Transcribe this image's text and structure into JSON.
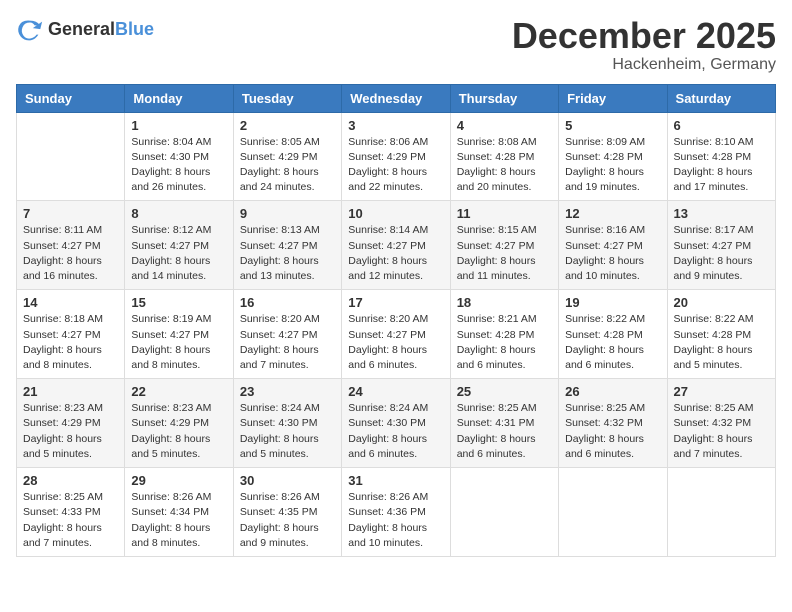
{
  "logo": {
    "text_general": "General",
    "text_blue": "Blue"
  },
  "title": {
    "month_year": "December 2025",
    "location": "Hackenheim, Germany"
  },
  "headers": [
    "Sunday",
    "Monday",
    "Tuesday",
    "Wednesday",
    "Thursday",
    "Friday",
    "Saturday"
  ],
  "weeks": [
    [
      {
        "day": "",
        "info": ""
      },
      {
        "day": "1",
        "info": "Sunrise: 8:04 AM\nSunset: 4:30 PM\nDaylight: 8 hours\nand 26 minutes."
      },
      {
        "day": "2",
        "info": "Sunrise: 8:05 AM\nSunset: 4:29 PM\nDaylight: 8 hours\nand 24 minutes."
      },
      {
        "day": "3",
        "info": "Sunrise: 8:06 AM\nSunset: 4:29 PM\nDaylight: 8 hours\nand 22 minutes."
      },
      {
        "day": "4",
        "info": "Sunrise: 8:08 AM\nSunset: 4:28 PM\nDaylight: 8 hours\nand 20 minutes."
      },
      {
        "day": "5",
        "info": "Sunrise: 8:09 AM\nSunset: 4:28 PM\nDaylight: 8 hours\nand 19 minutes."
      },
      {
        "day": "6",
        "info": "Sunrise: 8:10 AM\nSunset: 4:28 PM\nDaylight: 8 hours\nand 17 minutes."
      }
    ],
    [
      {
        "day": "7",
        "info": "Sunrise: 8:11 AM\nSunset: 4:27 PM\nDaylight: 8 hours\nand 16 minutes."
      },
      {
        "day": "8",
        "info": "Sunrise: 8:12 AM\nSunset: 4:27 PM\nDaylight: 8 hours\nand 14 minutes."
      },
      {
        "day": "9",
        "info": "Sunrise: 8:13 AM\nSunset: 4:27 PM\nDaylight: 8 hours\nand 13 minutes."
      },
      {
        "day": "10",
        "info": "Sunrise: 8:14 AM\nSunset: 4:27 PM\nDaylight: 8 hours\nand 12 minutes."
      },
      {
        "day": "11",
        "info": "Sunrise: 8:15 AM\nSunset: 4:27 PM\nDaylight: 8 hours\nand 11 minutes."
      },
      {
        "day": "12",
        "info": "Sunrise: 8:16 AM\nSunset: 4:27 PM\nDaylight: 8 hours\nand 10 minutes."
      },
      {
        "day": "13",
        "info": "Sunrise: 8:17 AM\nSunset: 4:27 PM\nDaylight: 8 hours\nand 9 minutes."
      }
    ],
    [
      {
        "day": "14",
        "info": "Sunrise: 8:18 AM\nSunset: 4:27 PM\nDaylight: 8 hours\nand 8 minutes."
      },
      {
        "day": "15",
        "info": "Sunrise: 8:19 AM\nSunset: 4:27 PM\nDaylight: 8 hours\nand 8 minutes."
      },
      {
        "day": "16",
        "info": "Sunrise: 8:20 AM\nSunset: 4:27 PM\nDaylight: 8 hours\nand 7 minutes."
      },
      {
        "day": "17",
        "info": "Sunrise: 8:20 AM\nSunset: 4:27 PM\nDaylight: 8 hours\nand 6 minutes."
      },
      {
        "day": "18",
        "info": "Sunrise: 8:21 AM\nSunset: 4:28 PM\nDaylight: 8 hours\nand 6 minutes."
      },
      {
        "day": "19",
        "info": "Sunrise: 8:22 AM\nSunset: 4:28 PM\nDaylight: 8 hours\nand 6 minutes."
      },
      {
        "day": "20",
        "info": "Sunrise: 8:22 AM\nSunset: 4:28 PM\nDaylight: 8 hours\nand 5 minutes."
      }
    ],
    [
      {
        "day": "21",
        "info": "Sunrise: 8:23 AM\nSunset: 4:29 PM\nDaylight: 8 hours\nand 5 minutes."
      },
      {
        "day": "22",
        "info": "Sunrise: 8:23 AM\nSunset: 4:29 PM\nDaylight: 8 hours\nand 5 minutes."
      },
      {
        "day": "23",
        "info": "Sunrise: 8:24 AM\nSunset: 4:30 PM\nDaylight: 8 hours\nand 5 minutes."
      },
      {
        "day": "24",
        "info": "Sunrise: 8:24 AM\nSunset: 4:30 PM\nDaylight: 8 hours\nand 6 minutes."
      },
      {
        "day": "25",
        "info": "Sunrise: 8:25 AM\nSunset: 4:31 PM\nDaylight: 8 hours\nand 6 minutes."
      },
      {
        "day": "26",
        "info": "Sunrise: 8:25 AM\nSunset: 4:32 PM\nDaylight: 8 hours\nand 6 minutes."
      },
      {
        "day": "27",
        "info": "Sunrise: 8:25 AM\nSunset: 4:32 PM\nDaylight: 8 hours\nand 7 minutes."
      }
    ],
    [
      {
        "day": "28",
        "info": "Sunrise: 8:25 AM\nSunset: 4:33 PM\nDaylight: 8 hours\nand 7 minutes."
      },
      {
        "day": "29",
        "info": "Sunrise: 8:26 AM\nSunset: 4:34 PM\nDaylight: 8 hours\nand 8 minutes."
      },
      {
        "day": "30",
        "info": "Sunrise: 8:26 AM\nSunset: 4:35 PM\nDaylight: 8 hours\nand 9 minutes."
      },
      {
        "day": "31",
        "info": "Sunrise: 8:26 AM\nSunset: 4:36 PM\nDaylight: 8 hours\nand 10 minutes."
      },
      {
        "day": "",
        "info": ""
      },
      {
        "day": "",
        "info": ""
      },
      {
        "day": "",
        "info": ""
      }
    ]
  ]
}
